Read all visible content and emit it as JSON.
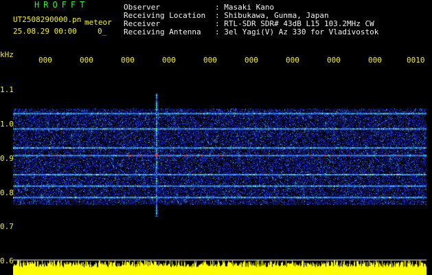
{
  "app": {
    "logo_text": "HROFFT"
  },
  "file": {
    "name": "UT2508290000.pn",
    "mode_label": "meteor",
    "datetime": "25.08.29 00:00",
    "extra": "0_"
  },
  "header": {
    "observer_label": "Observer",
    "observer_value": ": Masaki Kano",
    "location_label": "Receiving Location",
    "location_value": ": Shibukawa, Gunma, Japan",
    "receiver_label": "Receiver",
    "receiver_value": ": RTL-SDR SDR# 43dB L15 103.2MHz CW",
    "antenna_label": "Receiving Antenna",
    "antenna_value": ": 3el Yagi(V) Az 330 for Vladivostok"
  },
  "axis": {
    "y_unit": "kHz",
    "y_ticks": [
      "1.1",
      "1.0",
      "0.9",
      "0.8",
      "0.7",
      "0.6"
    ],
    "x_ticks": [
      "000",
      "000",
      "000",
      "000",
      "000",
      "000",
      "000",
      "000",
      "000",
      "0010"
    ]
  },
  "colors": {
    "background": "#000000",
    "label_yellow": "#f2f22a",
    "logo_green": "#31f23a",
    "spectrum_blue": "#1a2ad8",
    "spectrum_red": "#ff3030",
    "baseline_yellow": "#ffff00"
  },
  "spectrogram": {
    "band_khz": [
      0.77,
      1.02
    ],
    "strong_lines_khz": [
      1.01,
      0.97,
      0.92,
      0.9,
      0.85,
      0.82,
      0.79
    ],
    "meteor_echo_time_fraction": 0.35
  }
}
